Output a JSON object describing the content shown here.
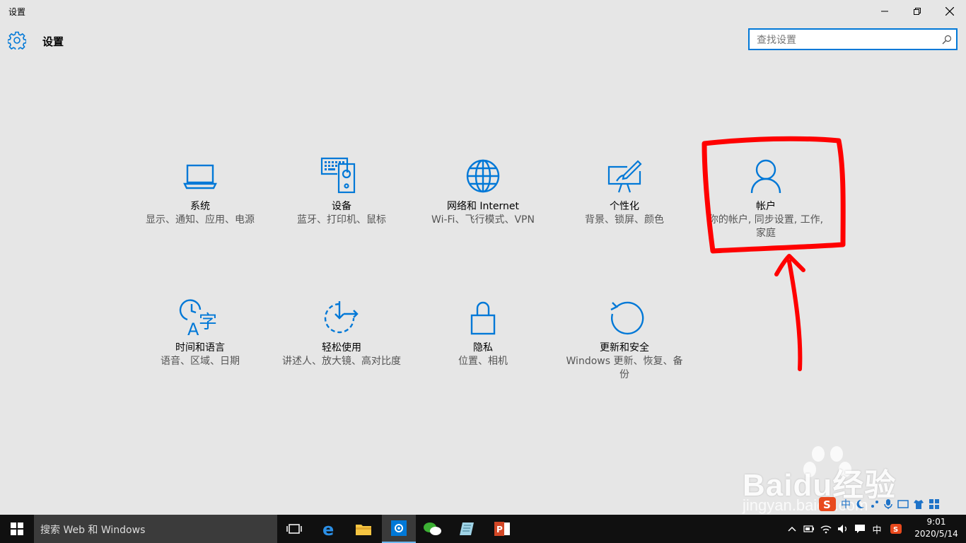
{
  "window": {
    "title": "设置"
  },
  "header": {
    "title": "设置",
    "search_placeholder": "查找设置"
  },
  "tiles": [
    {
      "name": "系统",
      "desc": "显示、通知、应用、电源",
      "icon": "laptop-icon"
    },
    {
      "name": "设备",
      "desc": "蓝牙、打印机、鼠标",
      "icon": "devices-icon"
    },
    {
      "name": "网络和 Internet",
      "desc": "Wi-Fi、飞行模式、VPN",
      "icon": "globe-icon"
    },
    {
      "name": "个性化",
      "desc": "背景、锁屏、颜色",
      "icon": "paint-icon"
    },
    {
      "name": "帐户",
      "desc": "你的帐户, 同步设置, 工作, 家庭",
      "icon": "person-icon"
    },
    {
      "name": "时间和语言",
      "desc": "语音、区域、日期",
      "icon": "clock-lang-icon"
    },
    {
      "name": "轻松使用",
      "desc": "讲述人、放大镜、高对比度",
      "icon": "ease-icon"
    },
    {
      "name": "隐私",
      "desc": "位置、相机",
      "icon": "lock-icon"
    },
    {
      "name": "更新和安全",
      "desc": "Windows 更新、恢复、备份",
      "icon": "refresh-icon"
    }
  ],
  "taskbar": {
    "search_text": "搜索 Web 和 Windows",
    "apps": [
      "task-view-icon",
      "edge-icon",
      "file-explorer-icon",
      "settings-app-icon",
      "wechat-icon",
      "notepad-icon",
      "powerpoint-icon"
    ],
    "tray": {
      "ime": "中"
    },
    "clock": {
      "time": "9:01",
      "date": "2020/5/14"
    }
  },
  "ime_bar": {
    "label": "中"
  },
  "watermark": {
    "text": "Baidu经验",
    "sub": "jingyan.baidu.com"
  },
  "colors": {
    "accent": "#0078d7",
    "annotation": "#ff0000",
    "background": "#e6e6e6",
    "taskbar": "#101010"
  }
}
